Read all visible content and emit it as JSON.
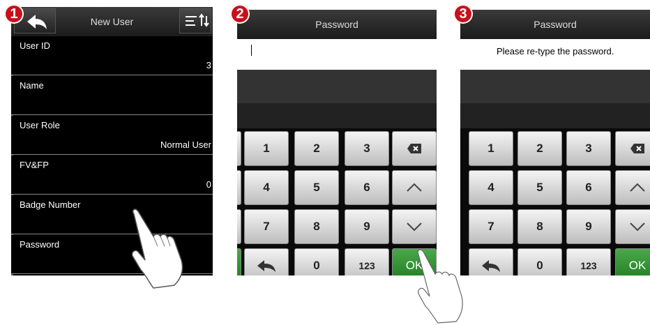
{
  "steps": [
    "1",
    "2",
    "3"
  ],
  "panel1": {
    "title": "New User",
    "back_icon": "back-arrow-icon",
    "sort_icon": "sort-icon",
    "rows": [
      {
        "label": "User ID",
        "value": "3"
      },
      {
        "label": "Name",
        "value": ""
      },
      {
        "label": "User Role",
        "value": "Normal User"
      },
      {
        "label": "FV&FP",
        "value": "0"
      },
      {
        "label": "Badge Number",
        "value": ""
      },
      {
        "label": "Password",
        "value": ""
      }
    ]
  },
  "panel2": {
    "title": "Password",
    "input_text": "",
    "keys": [
      "1",
      "2",
      "3",
      "4",
      "5",
      "6",
      "7",
      "8",
      "9",
      "0",
      "123",
      "OK"
    ]
  },
  "panel3": {
    "title": "Password",
    "prompt": "Please re-type the password.",
    "keys": [
      "1",
      "2",
      "3",
      "4",
      "5",
      "6",
      "7",
      "8",
      "9",
      "0",
      "123",
      "OK"
    ]
  },
  "colors": {
    "ok_green": "#2f8f2f",
    "step_red": "#c8101a"
  }
}
